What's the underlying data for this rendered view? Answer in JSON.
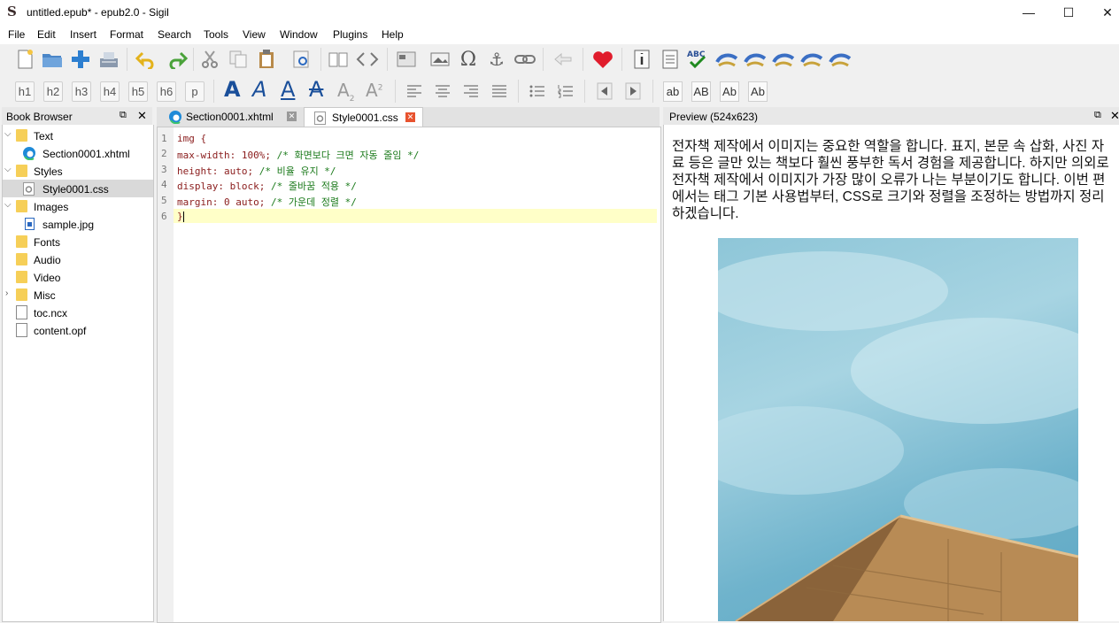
{
  "window": {
    "title": "untitled.epub* - epub2.0 - Sigil",
    "logo": "S",
    "minimize": "—",
    "maximize": "☐",
    "close": "✕"
  },
  "menu": [
    "File",
    "Edit",
    "Insert",
    "Format",
    "Search",
    "Tools",
    "View",
    "Window",
    "Plugins",
    "Help"
  ],
  "heading_buttons": [
    "h1",
    "h2",
    "h3",
    "h4",
    "h5",
    "h6",
    "p"
  ],
  "case_buttons": [
    "ab",
    "AB",
    "Ab",
    "Ab"
  ],
  "book_browser": {
    "title": "Book Browser",
    "items": [
      {
        "label": "Text",
        "type": "folder",
        "expanded": true
      },
      {
        "label": "Section0001.xhtml",
        "type": "file"
      },
      {
        "label": "Styles",
        "type": "folder",
        "expanded": true
      },
      {
        "label": "Style0001.css",
        "type": "file",
        "selected": true
      },
      {
        "label": "Images",
        "type": "folder",
        "expanded": true
      },
      {
        "label": "sample.jpg",
        "type": "file"
      },
      {
        "label": "Fonts",
        "type": "folder"
      },
      {
        "label": "Audio",
        "type": "folder"
      },
      {
        "label": "Video",
        "type": "folder"
      },
      {
        "label": "Misc",
        "type": "folder",
        "collapsed": true
      },
      {
        "label": "toc.ncx",
        "type": "file"
      },
      {
        "label": "content.opf",
        "type": "file"
      }
    ]
  },
  "tabs": [
    {
      "label": "Section0001.xhtml",
      "active": false
    },
    {
      "label": "Style0001.css",
      "active": true
    }
  ],
  "editor": {
    "lines": [
      {
        "num": "1",
        "prop": "img {",
        "comment": ""
      },
      {
        "num": "2",
        "prop": "max-width: 100%;",
        "comment": " /* 화면보다 크면 자동 줄임 */"
      },
      {
        "num": "3",
        "prop": "height: auto;",
        "comment": " /* 비율 유지 */"
      },
      {
        "num": "4",
        "prop": "display: block;",
        "comment": " /* 줄바꿈 적용 */"
      },
      {
        "num": "5",
        "prop": "margin: 0 auto;",
        "comment": " /* 가운데 정렬 */"
      },
      {
        "num": "6",
        "prop": "}",
        "comment": ""
      }
    ]
  },
  "preview": {
    "title": "Preview (524x623)",
    "text": "전자책 제작에서 이미지는 중요한 역할을 합니다. 표지, 본문 속 삽화, 사진 자료 등은 글만 있는 책보다 훨씬 풍부한 독서 경험을 제공합니다. 하지만 의외로 전자책 제작에서 이미지가 가장 많이 오류가 나는 부분이기도 합니다. 이번 편에서는 태그 기본 사용법부터, CSS로 크기와 정렬을 조정하는 방법까지 정리하겠습니다."
  }
}
